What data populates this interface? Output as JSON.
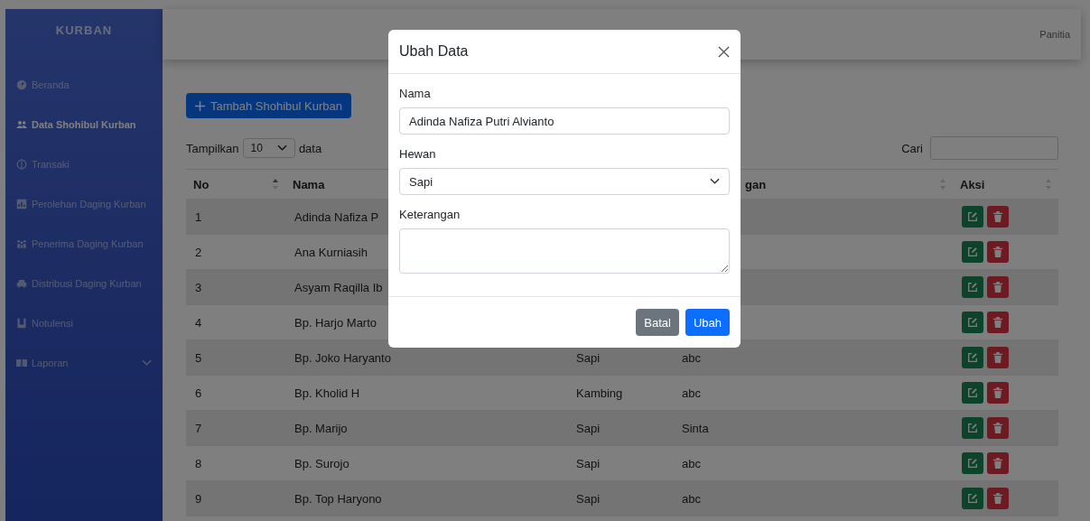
{
  "sidebar": {
    "brand": "KURBAN",
    "items": [
      {
        "label": "Beranda",
        "selected": false
      },
      {
        "label": "Data Shohibul Kurban",
        "selected": true
      },
      {
        "label": "Transaki",
        "selected": false
      },
      {
        "label": "Perolehan Daging Kurban",
        "selected": false
      },
      {
        "label": "Penerima Daging Kurban",
        "selected": false
      },
      {
        "label": "Distribusi Daging Kurban",
        "selected": false
      },
      {
        "label": "Notulensi",
        "selected": false
      },
      {
        "label": "Laporan",
        "selected": false,
        "expanded": false
      }
    ]
  },
  "topbar": {
    "user": "Panitia"
  },
  "content": {
    "add_button": "Tambah Shohibul Kurban",
    "length": {
      "label_before": "Tampilkan",
      "value": "10",
      "label_after": "data"
    },
    "search": {
      "label": "Cari"
    },
    "table": {
      "columns": [
        {
          "label": "No",
          "sorted": true
        },
        {
          "label": "Nama"
        },
        {},
        {
          "label": "gan",
          "sorted": false
        },
        {
          "label": "Aksi",
          "sorted": false
        }
      ],
      "rows": [
        {
          "no": "1",
          "nama": "Adinda Nafiza P"
        },
        {
          "no": "2",
          "nama": "Ana Kurniasih"
        },
        {
          "no": "3",
          "nama": "Asyam Raqilla Ib"
        },
        {
          "no": "4",
          "nama": "Bp. Harjo Marto"
        },
        {
          "no": "5",
          "nama": "Bp. Joko Haryanto",
          "hewan": "Sapi",
          "keterangan": "abc"
        },
        {
          "no": "6",
          "nama": "Bp. Kholid H",
          "hewan": "Kambing",
          "keterangan": "abc"
        },
        {
          "no": "7",
          "nama": "Bp. Marijo",
          "hewan": "Sapi",
          "keterangan": "Sinta"
        },
        {
          "no": "8",
          "nama": "Bp. Surojo",
          "hewan": "Sapi",
          "keterangan": "abc"
        },
        {
          "no": "9",
          "nama": "Bp. Top Haryono",
          "hewan": "Sapi",
          "keterangan": "abc"
        }
      ]
    }
  },
  "modal": {
    "title": "Ubah Data",
    "fields": [
      {
        "kind": "text",
        "label": "Nama",
        "value": "Adinda Nafiza Putri Alvianto"
      },
      {
        "kind": "select",
        "label": "Hewan",
        "value": "Sapi"
      },
      {
        "kind": "textarea",
        "label": "Keterangan"
      }
    ],
    "buttons": [
      {
        "kind": "secondary",
        "label": "Batal"
      },
      {
        "kind": "primary",
        "label": "Ubah"
      }
    ]
  }
}
